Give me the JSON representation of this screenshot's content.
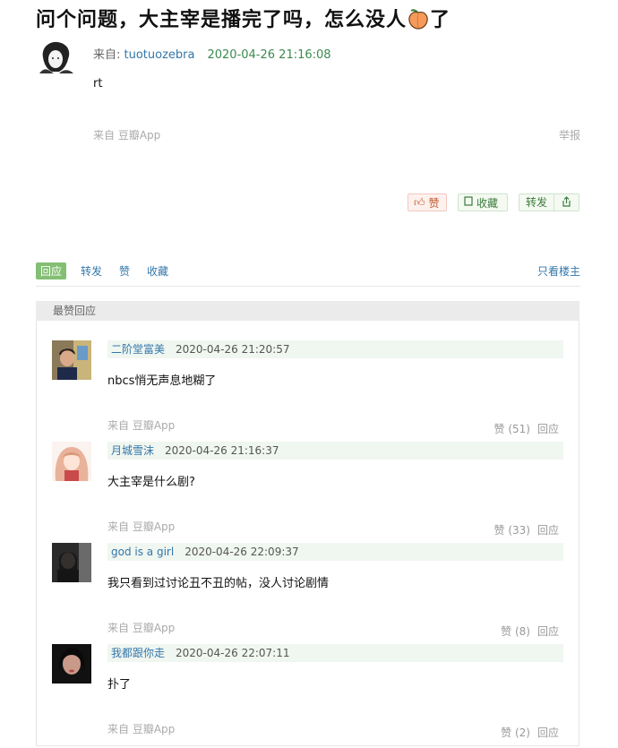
{
  "post": {
    "title": "问个问题，大主宰是播完了吗，怎么没人",
    "title_tail": "了",
    "author_prefix": "来自: ",
    "author": "tuotuozebra",
    "time": "2020-04-26 21:16:08",
    "body": "rt",
    "from": "来自 豆瓣App",
    "report": "举报",
    "actions": {
      "like": "赞",
      "collect": "收藏",
      "share": "转发"
    }
  },
  "tabs": {
    "items": [
      "回应",
      "转发",
      "赞",
      "收藏"
    ],
    "only_op": "只看楼主"
  },
  "best": {
    "header": "最赞回应",
    "replies": [
      {
        "name": "二阶堂富美",
        "time": "2020-04-26 21:20:57",
        "text": "nbcs悄无声息地糊了",
        "from": "来自 豆瓣App",
        "likes": "赞 (51)",
        "reply": "回应"
      },
      {
        "name": "月城雪沫",
        "time": "2020-04-26 21:16:37",
        "text": "大主宰是什么剧?",
        "from": "来自 豆瓣App",
        "likes": "赞 (33)",
        "reply": "回应"
      },
      {
        "name": "god is a girl",
        "time": "2020-04-26 22:09:37",
        "text": "我只看到过讨论丑不丑的帖，没人讨论剧情",
        "from": "来自 豆瓣App",
        "likes": "赞 (8)",
        "reply": "回应"
      },
      {
        "name": "我都跟你走",
        "time": "2020-04-26 22:07:11",
        "text": "扑了",
        "from": "来自 豆瓣App",
        "likes": "赞 (2)",
        "reply": "回应"
      }
    ]
  },
  "colors": {
    "link": "#3377aa",
    "time_green": "#3a8a4f",
    "tab_active": "#83bf73",
    "like_btn": "#c0582e"
  }
}
